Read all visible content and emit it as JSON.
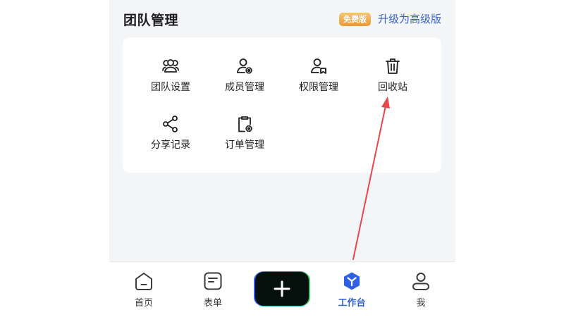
{
  "header": {
    "title": "团队管理",
    "badge": "免费版",
    "upgrade": "升级为高级版"
  },
  "grid": [
    {
      "label": "团队设置",
      "icon": "users-icon"
    },
    {
      "label": "成员管理",
      "icon": "user-gear-icon"
    },
    {
      "label": "权限管理",
      "icon": "user-bookmark-icon"
    },
    {
      "label": "回收站",
      "icon": "trash-icon"
    },
    {
      "label": "分享记录",
      "icon": "share-icon"
    },
    {
      "label": "订单管理",
      "icon": "clipboard-gear-icon"
    }
  ],
  "tabs": [
    {
      "label": "首页",
      "icon": "home-icon"
    },
    {
      "label": "表单",
      "icon": "form-icon"
    },
    {
      "label": "",
      "icon": "plus-icon"
    },
    {
      "label": "工作台",
      "icon": "workbench-icon",
      "active": true
    },
    {
      "label": "我",
      "icon": "profile-icon"
    }
  ],
  "colors": {
    "accent": "#2f5fe3",
    "link": "#3b64c8",
    "badge": "#e9993a",
    "annotation": "#e8474c"
  }
}
